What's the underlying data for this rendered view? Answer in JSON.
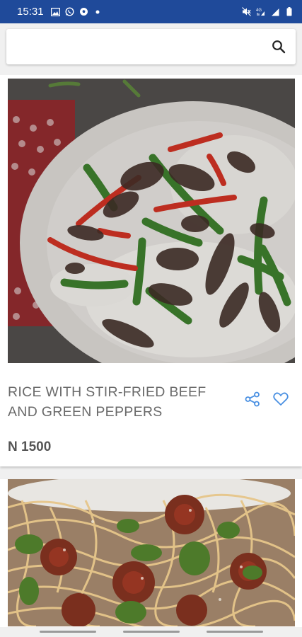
{
  "status_bar": {
    "time": "15:31",
    "background": "#1f4a9a",
    "left_icons": [
      "image-icon",
      "whatsapp-icon",
      "soccer-ball-icon",
      "dot-icon"
    ],
    "right_icons": [
      "mute-icon",
      "4g-signal-icon",
      "signal-icon",
      "battery-icon"
    ]
  },
  "search": {
    "value": "",
    "placeholder": "",
    "icon": "search-icon"
  },
  "products": [
    {
      "title": "RICE WITH STIR-FRIED BEEF AND GREEN PEPPERS",
      "price": "N 1500",
      "image": "beef-stir-fry-photo",
      "actions": [
        "share-icon",
        "heart-icon"
      ]
    },
    {
      "image": "spaghetti-meatballs-photo"
    }
  ],
  "colors": {
    "accent": "#4a90e2",
    "title_text": "#6a6a6a",
    "price_text": "#555555"
  }
}
